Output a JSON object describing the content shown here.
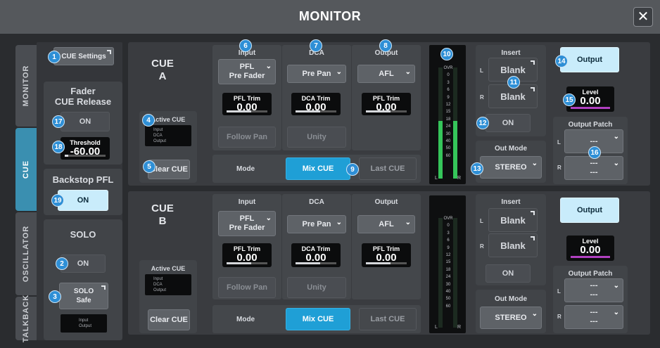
{
  "window": {
    "title": "MONITOR",
    "close_label": "✕"
  },
  "tabs": [
    "MONITOR",
    "CUE",
    "OSCILLATOR",
    "TALKBACK"
  ],
  "side": {
    "cue_settings": "CUE Settings",
    "fader_cue_release": "Fader\nCUE Release",
    "fader_on": "ON",
    "threshold_label": "Threshold",
    "threshold_value": "-60.00",
    "backstop_pfl": "Backstop PFL",
    "backstop_on": "ON",
    "solo": "SOLO",
    "solo_on": "ON",
    "solo_safe": "SOLO\nSafe",
    "solo_legend": "Input\nOutput"
  },
  "cue_a": {
    "name": "CUE",
    "letter": "A",
    "active_cue_label": "Active CUE",
    "active_cue_items": "Input\nDCA\nOutput",
    "clear_cue": "Clear CUE",
    "input_label": "Input",
    "input_value": "PFL\nPre Fader",
    "input_trim_label": "PFL Trim",
    "input_trim_value": "0.00",
    "follow_pan": "Follow Pan",
    "dca_label": "DCA",
    "dca_value": "Pre Pan",
    "dca_trim_label": "DCA Trim",
    "dca_trim_value": "0.00",
    "unity": "Unity",
    "output_label": "Output",
    "output_value": "AFL",
    "output_trim_label": "PFL Trim",
    "output_trim_value": "0.00",
    "mode": "Mode",
    "mix_cue": "Mix CUE",
    "last_cue": "Last CUE",
    "insert_label": "Insert",
    "insert_l": "Blank",
    "insert_r": "Blank",
    "insert_l_ch": "L",
    "insert_r_ch": "R",
    "insert_on": "ON",
    "out_mode_label": "Out Mode",
    "out_mode_value": "STEREO",
    "output_btn": "Output",
    "level_label": "Level",
    "level_value": "0.00",
    "output_patch_label": "Output Patch",
    "patch_l": "---",
    "patch_r": "---\n---",
    "patch_l_ch": "L",
    "patch_r_ch": "R"
  },
  "cue_b": {
    "name": "CUE",
    "letter": "B",
    "active_cue_label": "Active CUE",
    "active_cue_items": "Input\nDCA\nOutput",
    "clear_cue": "Clear CUE",
    "input_label": "Input",
    "input_value": "PFL\nPre Fader",
    "input_trim_label": "PFL Trim",
    "input_trim_value": "0.00",
    "follow_pan": "Follow Pan",
    "dca_label": "DCA",
    "dca_value": "Pre Pan",
    "dca_trim_label": "DCA Trim",
    "dca_trim_value": "0.00",
    "unity": "Unity",
    "output_label": "Output",
    "output_value": "AFL",
    "output_trim_label": "PFL Trim",
    "output_trim_value": "0.00",
    "mode": "Mode",
    "mix_cue": "Mix CUE",
    "last_cue": "Last CUE",
    "insert_label": "Insert",
    "insert_l": "Blank",
    "insert_r": "Blank",
    "insert_l_ch": "L",
    "insert_r_ch": "R",
    "insert_on": "ON",
    "out_mode_label": "Out Mode",
    "out_mode_value": "STEREO",
    "output_btn": "Output",
    "level_label": "Level",
    "level_value": "0.00",
    "output_patch_label": "Output Patch",
    "patch_l": "---\n---",
    "patch_r": "---\n---",
    "patch_l_ch": "L",
    "patch_r_ch": "R"
  },
  "meter_scale": [
    "OVR",
    "0",
    "3",
    "6",
    "9",
    "12",
    "15",
    "18",
    "24",
    "30",
    "40",
    "50",
    "60"
  ],
  "meter_lr": [
    "L",
    "R"
  ],
  "callouts": [
    "1",
    "2",
    "3",
    "4",
    "5",
    "6",
    "7",
    "8",
    "9",
    "10",
    "11",
    "12",
    "13",
    "14",
    "15",
    "16",
    "17",
    "18",
    "19"
  ],
  "colors": {
    "accent": "#1f9fd6",
    "active_tab": "#3a8fb0",
    "on_button": "#c9ecfb",
    "level_bar": "#b040c0",
    "meter_green": "#35c55a",
    "callout": "#2e8fd6"
  }
}
